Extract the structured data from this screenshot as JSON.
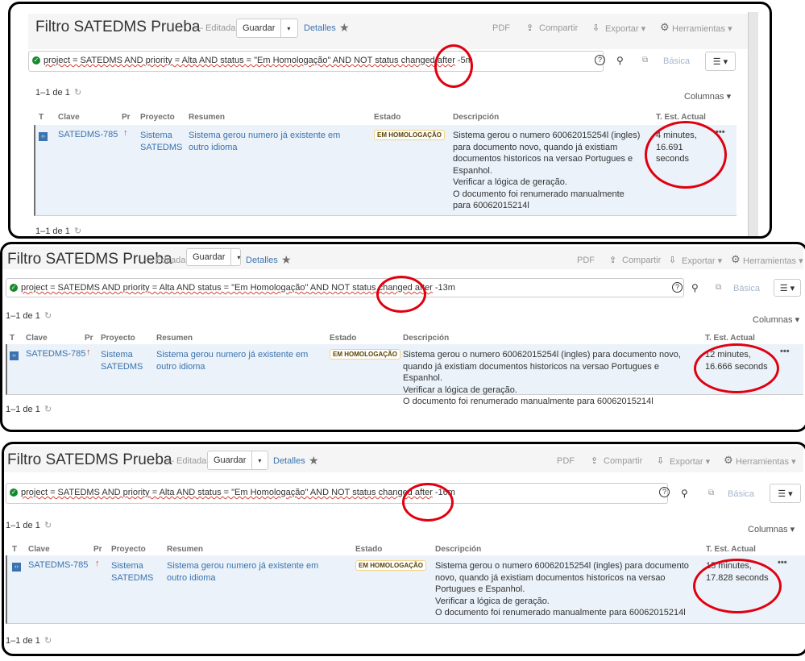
{
  "panels": [
    {
      "query_value": "-5m",
      "time": "4 minutes, 16.691 seconds"
    },
    {
      "query_value": "-13m",
      "time": "12 minutes, 16.666 seconds"
    },
    {
      "query_value": "-16m",
      "time": "15 minutes, 17.828 seconds"
    }
  ],
  "header": {
    "title": "Filtro SATEDMS Prueba",
    "edited": "— Editada",
    "save": "Guardar",
    "details": "Detalles",
    "pdf": "PDF",
    "share": "Compartir",
    "export": "Exportar ▾",
    "tools": "Herramientas ▾"
  },
  "query": {
    "text": "project = SATEDMS AND priority = Alta AND status = \"Em Homologação\" AND NOT status changed after",
    "basic": "Básica"
  },
  "results": {
    "count": "1–1 de 1",
    "columns": "Columnas ▾"
  },
  "table": {
    "headers": [
      "T",
      "Clave",
      "Pr",
      "Proyecto",
      "Resumen",
      "Estado",
      "Descripción",
      "T. Est. Actual"
    ],
    "row": {
      "key": "SATEDMS-785",
      "project": "Sistema SATEDMS",
      "summary": "Sistema gerou numero já existente em outro idioma",
      "status": "EM HOMOLOGAÇÃO",
      "description": [
        "Sistema gerou o numero 60062015254l (ingles) para documento novo, quando já existiam documentos historicos na versao Portugues e Espanhol.",
        "Verificar a lógica de geração.",
        "O documento foi renumerado manualmente para 60062015214l"
      ]
    }
  }
}
